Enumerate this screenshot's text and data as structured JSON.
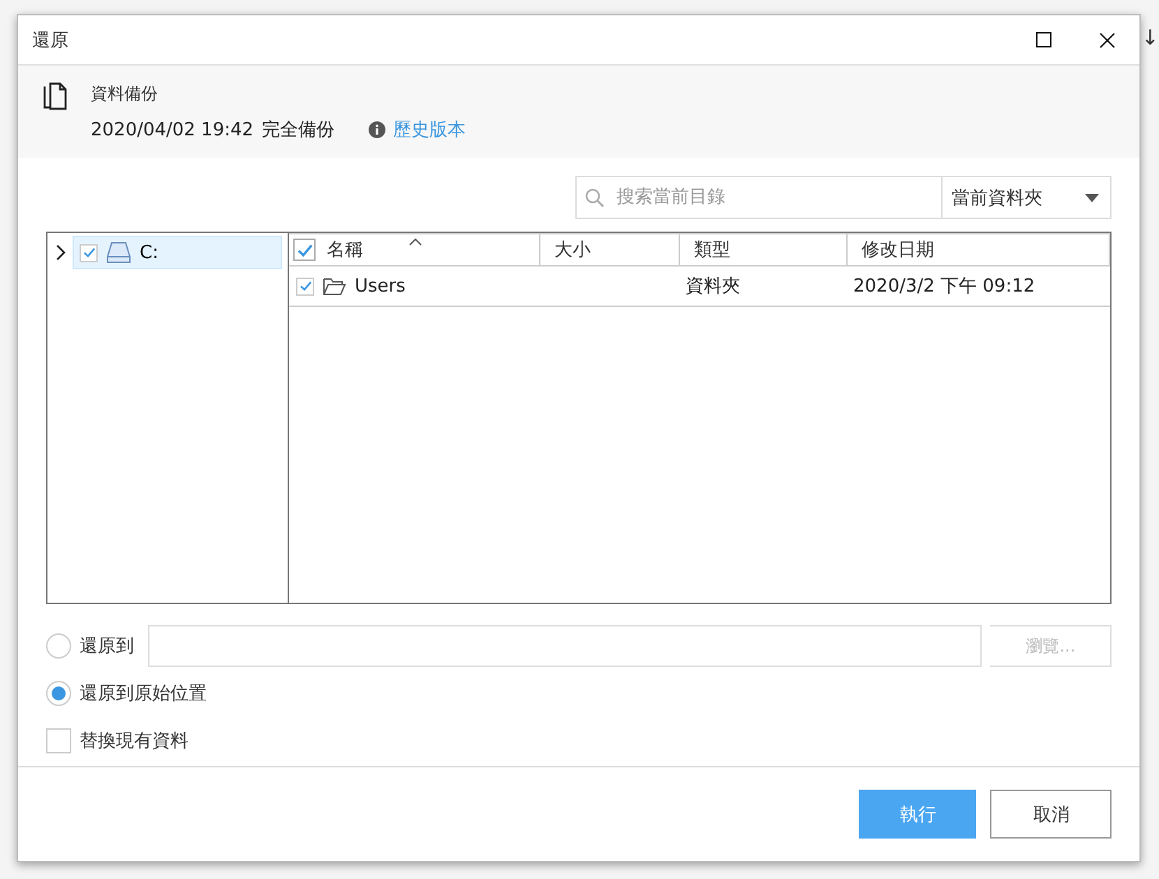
{
  "backdrop": {
    "glyph": "↓"
  },
  "window": {
    "title": "還原"
  },
  "header": {
    "name": "資料備份",
    "timestamp": "2020/04/02 19:42",
    "backup_type": "完全備份",
    "history_link": "歷史版本"
  },
  "search": {
    "placeholder": "搜索當前目錄",
    "scope": "當前資料夾"
  },
  "tree": [
    {
      "label": "C:",
      "checked": true,
      "expanded": false,
      "selected": true
    }
  ],
  "table": {
    "select_all_checked": true,
    "columns": [
      "名稱",
      "大小",
      "類型",
      "修改日期"
    ],
    "rows": [
      {
        "name": "Users",
        "checked": true,
        "type": "資料夾",
        "modified": "2020/3/2 下午 09:12"
      }
    ]
  },
  "restore_options": [
    {
      "label": "還原到",
      "selected": false,
      "browse": "瀏覽..."
    },
    {
      "label": "還原到原始位置",
      "selected": true
    }
  ],
  "replace_existing": {
    "label": "替換現有資料",
    "checked": false
  },
  "buttons": [
    {
      "label": "執行",
      "kind": "primary"
    },
    {
      "label": "取消",
      "kind": "secondary"
    }
  ]
}
